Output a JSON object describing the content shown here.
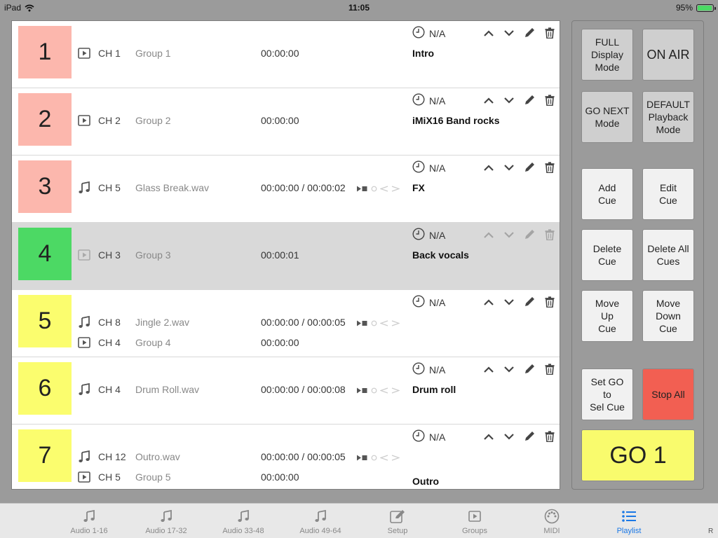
{
  "status_bar": {
    "device": "iPad",
    "time": "11:05",
    "battery": "95%",
    "battery_level": 0.95
  },
  "cues": [
    {
      "number": "1",
      "color": "#fcb7ad",
      "selected": false,
      "tracks": [
        {
          "icon": "play-square-icon",
          "channel": "CH 1",
          "name": "Group 1",
          "time": "00:00:00",
          "controls": false
        }
      ],
      "clock": "N/A",
      "note": "Intro"
    },
    {
      "number": "2",
      "color": "#fcb7ad",
      "selected": false,
      "tracks": [
        {
          "icon": "play-square-icon",
          "channel": "CH 2",
          "name": "Group 2",
          "time": "00:00:00",
          "controls": false
        }
      ],
      "clock": "N/A",
      "note": "iMiX16 Band rocks"
    },
    {
      "number": "3",
      "color": "#fcb7ad",
      "selected": false,
      "tracks": [
        {
          "icon": "music-note-icon",
          "channel": "CH 5",
          "name": "Glass Break.wav",
          "time": "00:00:00 / 00:00:02",
          "controls": true
        }
      ],
      "clock": "N/A",
      "note": "FX"
    },
    {
      "number": "4",
      "color": "#4cd964",
      "selected": true,
      "tracks": [
        {
          "icon": "play-square-icon",
          "channel": "CH 3",
          "name": "Group 3",
          "time": "00:00:01",
          "controls": false
        }
      ],
      "clock": "N/A",
      "note": "Back vocals"
    },
    {
      "number": "5",
      "color": "#fbfd6e",
      "selected": false,
      "tracks": [
        {
          "icon": "music-note-icon",
          "channel": "CH 8",
          "name": "Jingle 2.wav",
          "time": "00:00:00 / 00:00:05",
          "controls": true
        },
        {
          "icon": "play-square-icon",
          "channel": "CH 4",
          "name": "Group 4",
          "time": "00:00:00",
          "controls": false
        }
      ],
      "clock": "N/A",
      "note": ""
    },
    {
      "number": "6",
      "color": "#fbfd6e",
      "selected": false,
      "tracks": [
        {
          "icon": "music-note-icon",
          "channel": "CH 4",
          "name": "Drum Roll.wav",
          "time": "00:00:00 / 00:00:08",
          "controls": true
        }
      ],
      "clock": "N/A",
      "note": "Drum roll"
    },
    {
      "number": "7",
      "color": "#fbfd6e",
      "selected": false,
      "tracks": [
        {
          "icon": "music-note-icon",
          "channel": "CH 12",
          "name": "Outro.wav",
          "time": "00:00:00 / 00:00:05",
          "controls": true
        },
        {
          "icon": "play-square-icon",
          "channel": "CH 5",
          "name": "Group 5",
          "time": "00:00:00",
          "controls": false
        }
      ],
      "clock": "N/A",
      "note": "Outro"
    }
  ],
  "panel": {
    "full_display": "FULL\nDisplay\nMode",
    "on_air": "ON AIR",
    "go_next": "GO NEXT\nMode",
    "default_playback": "DEFAULT\nPlayback\nMode",
    "add_cue": "Add\nCue",
    "edit_cue": "Edit\nCue",
    "delete_cue": "Delete\nCue",
    "delete_all": "Delete All\nCues",
    "move_up": "Move\nUp\nCue",
    "move_down": "Move\nDown\nCue",
    "set_go": "Set GO\nto\nSel Cue",
    "stop_all": "Stop All",
    "go": "GO 1"
  },
  "tabs": [
    {
      "label": "Audio 1-16",
      "icon": "music-note-icon",
      "active": false
    },
    {
      "label": "Audio 17-32",
      "icon": "music-note-icon",
      "active": false
    },
    {
      "label": "Audio 33-48",
      "icon": "music-note-icon",
      "active": false
    },
    {
      "label": "Audio 49-64",
      "icon": "music-note-icon",
      "active": false
    },
    {
      "label": "Setup",
      "icon": "pencil-square-icon",
      "active": false
    },
    {
      "label": "Groups",
      "icon": "play-square-icon",
      "active": false
    },
    {
      "label": "MIDI",
      "icon": "midi-port-icon",
      "active": false
    },
    {
      "label": "Playlist",
      "icon": "list-icon",
      "active": true
    }
  ],
  "tab_corner": "R"
}
